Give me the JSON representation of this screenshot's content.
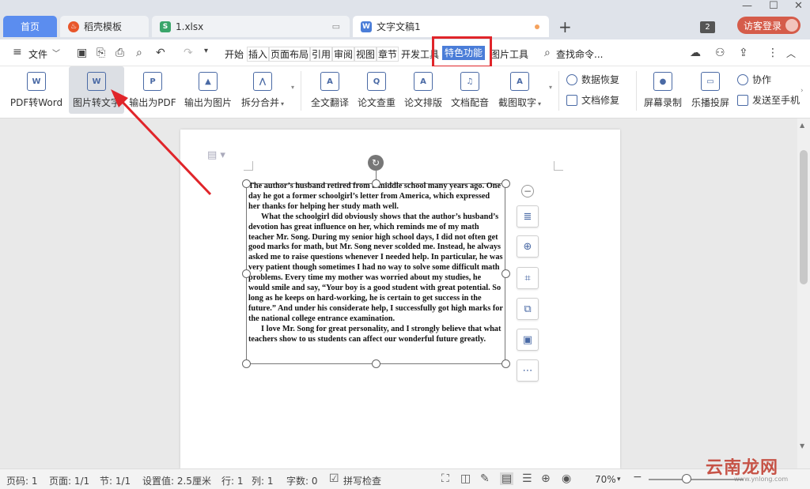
{
  "tabs": [
    {
      "label": "首页",
      "type": "home"
    },
    {
      "label": "稻壳模板",
      "icon": "daoke-flame-icon",
      "color": "#e8562a"
    },
    {
      "label": "1.xlsx",
      "icon": "spreadsheet-icon",
      "color": "#3aa56a",
      "icon_glyph": "S"
    },
    {
      "label": "文字文稿1",
      "icon": "writer-doc-icon",
      "color": "#4a7dd8",
      "icon_glyph": "W",
      "active": true
    }
  ],
  "tabbar": {
    "new_tab": "+",
    "window_count": "2",
    "login_label": "访客登录"
  },
  "menubar": {
    "file_label": "文件",
    "items": [
      "开始",
      "插入",
      "页面布局",
      "引用",
      "审阅",
      "视图",
      "章节",
      "开发工具",
      "特色功能",
      "图片工具"
    ],
    "active_item": "特色功能",
    "search_label": "查找命令..."
  },
  "ribbon": {
    "large_buttons": [
      {
        "label": "PDF转Word",
        "glyph": "W"
      },
      {
        "label": "图片转文字",
        "glyph": "W",
        "highlighted": true
      },
      {
        "label": "输出为PDF",
        "glyph": "P"
      },
      {
        "label": "输出为图片",
        "glyph": "▲"
      },
      {
        "label": "拆分合并",
        "glyph": "⋀",
        "dropdown": true
      },
      {
        "label": "全文翻译",
        "glyph": "A"
      },
      {
        "label": "论文查重",
        "glyph": "Q"
      },
      {
        "label": "论文排版",
        "glyph": "A"
      },
      {
        "label": "文档配音",
        "glyph": "♫"
      },
      {
        "label": "截图取字",
        "glyph": "A",
        "dropdown": true
      },
      {
        "label": "屏幕录制",
        "glyph": "●"
      },
      {
        "label": "乐播投屏",
        "glyph": "▭"
      }
    ],
    "small_buttons": [
      {
        "label": "数据恢复"
      },
      {
        "label": "文档修复"
      },
      {
        "label": "协作"
      },
      {
        "label": "发送至手机"
      }
    ]
  },
  "document": {
    "paragraphs": [
      "The author’s husband retired from a middle school many years ago. One day he got a former schoolgirl’s letter from America, which expressed her thanks for helping her study math well.",
      "What the schoolgirl did obviously shows that the author’s husband’s devotion has great influence on her, which reminds me of my math teacher Mr. Song. During my senior high school days, I did not often get good marks for math, but Mr. Song never scolded me. Instead, he always asked me to raise questions whenever I needed help. In particular, he was very patient though sometimes I had no way to solve some difficult math problems. Every time my mother was worried about my studies, he would smile and say, “Your boy is a good student with great potential. So long as he keeps on hard-working, he is certain to get success in the future.” And under his considerate help, I successfully got high marks for the national college entrance examination.",
      "I love Mr. Song for great personality, and I strongly believe that what teachers show to us students can affect our wonderful future greatly."
    ]
  },
  "float_toolbar": [
    "collapse-icon",
    "text-wrap-icon",
    "zoom-in-icon",
    "crop-icon",
    "image-to-text-icon",
    "replace-image-icon",
    "more-icon"
  ],
  "statusbar": {
    "page_num": "页码: 1",
    "pages": "页面: 1/1",
    "section": "节: 1/1",
    "setting": "设置值: 2.5厘米",
    "row": "行: 1",
    "col": "列: 1",
    "word_count": "字数: 0",
    "spell_check": "拼写检查",
    "zoom": "70%"
  },
  "watermark": {
    "text": "云南龙网",
    "sub": "www.ynlong.com"
  },
  "colors": {
    "accent": "#4a7dd8",
    "annotation": "#e0252a",
    "home_tab": "#5b8def",
    "login": "#d55c4a"
  }
}
